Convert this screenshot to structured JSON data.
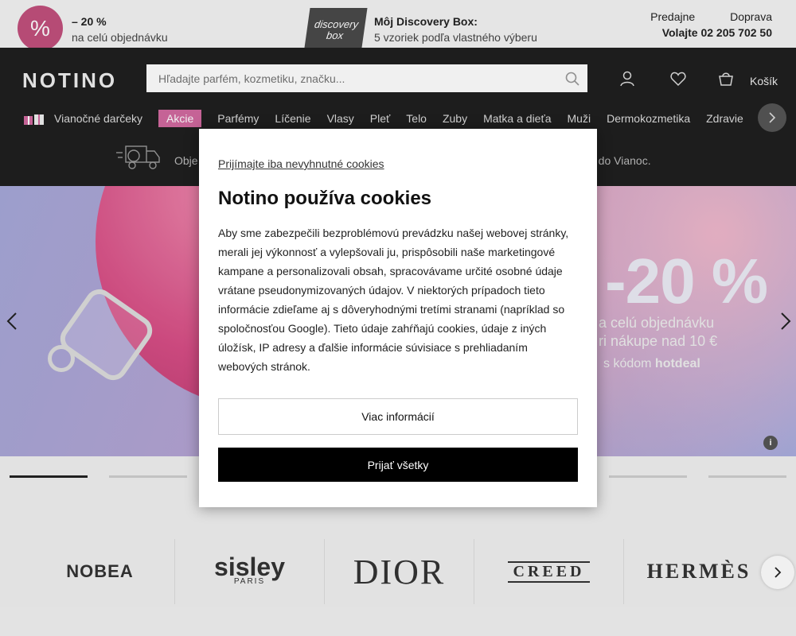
{
  "topbar": {
    "promo_badge": "%",
    "promo_title": "– 20 %",
    "promo_sub": "na celú objednávku",
    "box_label": "discovery box",
    "discovery_title": "Môj Discovery Box:",
    "discovery_sub": "5 vzoriek podľa vlastného výberu",
    "link_stores": "Predajne",
    "link_delivery": "Doprava",
    "phone": "Volajte 02 205 702 50"
  },
  "header": {
    "logo": "NOTINO",
    "search_placeholder": "Hľadajte parfém, kozmetiku, značku...",
    "cart_label": "Košík",
    "notice_left": "Obje",
    "notice_right": "čas do Vianoc."
  },
  "nav": {
    "items": [
      "Vianočné darčeky",
      "Akcie",
      "Parfémy",
      "Líčenie",
      "Vlasy",
      "Pleť",
      "Telo",
      "Zuby",
      "Matka a dieťa",
      "Muži",
      "Dermokozmetika",
      "Zdravie"
    ]
  },
  "hero": {
    "big": "-20 %",
    "line1": "a celú objednávku",
    "line2": "ri nákupe nad 10 €",
    "line3_prefix": "s kódom ",
    "line3_code": "hotdeal",
    "info": "i",
    "slides_count": 8,
    "active_slide": 1
  },
  "brands": {
    "items": [
      "NOBEA",
      "sisley",
      "DIOR",
      "CREED",
      "HERMÈS"
    ],
    "sisley_sub": "PARIS"
  },
  "cookie": {
    "link": "Prijímajte iba nevyhnutné cookies",
    "title": "Notino používa cookies",
    "body": "Aby sme zabezpečili bezproblémovú prevádzku našej webovej stránky, merali jej výkonnosť a vylepšovali ju, prispôsobili naše marketingové kampane a personalizovali obsah, spracovávame určité osobné údaje vrátane pseudonymizovaných údajov. V niektorých prípadoch tieto informácie zdieľame aj s dôveryhodnými tretími stranami (napríklad so spoločnosťou Google). Tieto údaje zahŕňajú cookies, údaje z iných úložísk, IP adresy a ďalšie informácie súvisiace s prehliadaním webových stránok.",
    "more_button": "Viac informácií",
    "accept_button": "Prijať všetky"
  },
  "colors": {
    "accent_pink": "#d26aa0",
    "header_bg": "#1f1f1f",
    "accept_bg": "#000000"
  }
}
